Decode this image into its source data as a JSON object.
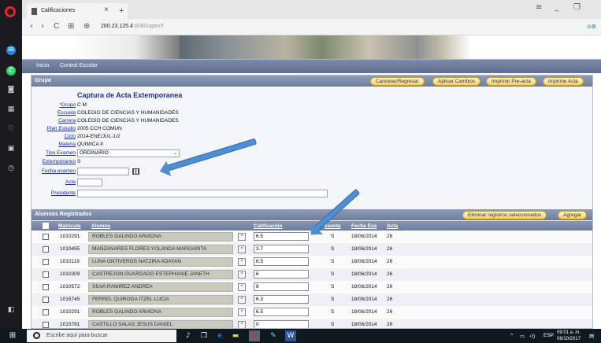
{
  "browser": {
    "tab_title": "Calificaciones",
    "tab_close": "×",
    "tab_new": "+",
    "url_host": "200.23.125.4",
    "url_rest": ":8080/apex/f",
    "nav": {
      "back": "‹",
      "forward": "›",
      "reload": "C",
      "grid": "⊞",
      "globe": "⊕"
    },
    "window": {
      "menu": "≡",
      "minimize": "_",
      "restore": "❐"
    },
    "addr_right": "o⊗"
  },
  "sidebar_icons": [
    "messenger-icon",
    "whatsapp-icon",
    "camera-icon",
    "grid-icon",
    "heart-icon",
    "box-icon",
    "clock-icon"
  ],
  "menubar": {
    "home": "Inicio",
    "school_control": "Control Escolar"
  },
  "group_section": {
    "title": "Grupo",
    "buttons": {
      "cancel": "Cancelar/Regresar",
      "apply": "Aplicar Cambios",
      "print_pre": "Imprimir Pre-acta",
      "print_acta": "Imprime Acta"
    },
    "heading": "Captura de Acta Extemporanea",
    "fields": {
      "grupo_label": "Grupo",
      "grupo_value": "C M",
      "escuela_label": "Escuela",
      "escuela_value": "COLEGIO DE CIENCIAS Y HUMANIDADES",
      "carrera_label": "Carrera",
      "carrera_value": "COLEGIO DE CIENCIAS Y HUMANIDADES",
      "plan_label": "Plan Estudio",
      "plan_value": "2005 CCH COMUN",
      "ciclo_label": "Ciclo",
      "ciclo_value": "2014-ENE/JUL-1/2",
      "materia_label": "Materia",
      "materia_value": "QUIMICA II",
      "tipo_label": "Tipo Examen",
      "tipo_value": "ORDINARIO",
      "extemp_label": "Extemporaneo",
      "extemp_value": "S",
      "fecha_label": "Fecha examen",
      "fecha_value": "",
      "acta_label": "Acta",
      "acta_value": "",
      "presidente_label": "Presidente",
      "presidente_value": ""
    }
  },
  "students_section": {
    "title": "Alumnos Registrados",
    "buttons": {
      "delete_selected": "Eliminar registros seleccionados",
      "add": "Agregar"
    },
    "columns": {
      "matricula": "Matricula",
      "alumno": "Alumno",
      "calificacion": "Calificación",
      "estatus": "ssente",
      "fecha": "Fecha Exa",
      "acta": "Acta"
    },
    "rows": [
      {
        "matricula": "1010291",
        "alumno": "ROBLES GALINDO ARIADNA",
        "calificacion": "6.5",
        "estatus": "S",
        "fecha": "18/06/2014",
        "acta": "26"
      },
      {
        "matricula": "1010455",
        "alumno": "MANZANARES FLORES YOLANDA MARGARITA",
        "calificacion": "3.7",
        "estatus": "S",
        "fecha": "18/06/2014",
        "acta": "26"
      },
      {
        "matricula": "1010119",
        "alumno": "LUNA ONTIVEROS NATZIRA ADAYAN",
        "calificacion": "6.5",
        "estatus": "S",
        "fecha": "18/06/2014",
        "acta": "26"
      },
      {
        "matricula": "1010309",
        "alumno": "CASTREJON GUARDADO ESTEPHANIE JANETH",
        "calificacion": "6",
        "estatus": "S",
        "fecha": "18/06/2014",
        "acta": "26"
      },
      {
        "matricula": "1010572",
        "alumno": "SILVA RAMIREZ ANDREA",
        "calificacion": "8",
        "estatus": "S",
        "fecha": "18/06/2014",
        "acta": "26"
      },
      {
        "matricula": "1015745",
        "alumno": "FERREL QUIROGA ITZEL LUCIA",
        "calificacion": "6.3",
        "estatus": "S",
        "fecha": "18/06/2014",
        "acta": "26"
      },
      {
        "matricula": "1010291",
        "alumno": "ROBLES GALINDO ARIADNA",
        "calificacion": "6.5",
        "estatus": "S",
        "fecha": "18/06/2014",
        "acta": "26"
      },
      {
        "matricula": "1015781",
        "alumno": "CASTILLO SALAS JESUS DANIEL",
        "calificacion": "0",
        "estatus": "S",
        "fecha": "18/06/2014",
        "acta": "26"
      }
    ]
  },
  "taskbar": {
    "search_placeholder": "Escribe aquí para buscar",
    "lang": "ESP",
    "time": "09:01 a. m.",
    "date": "06/10/2017"
  }
}
